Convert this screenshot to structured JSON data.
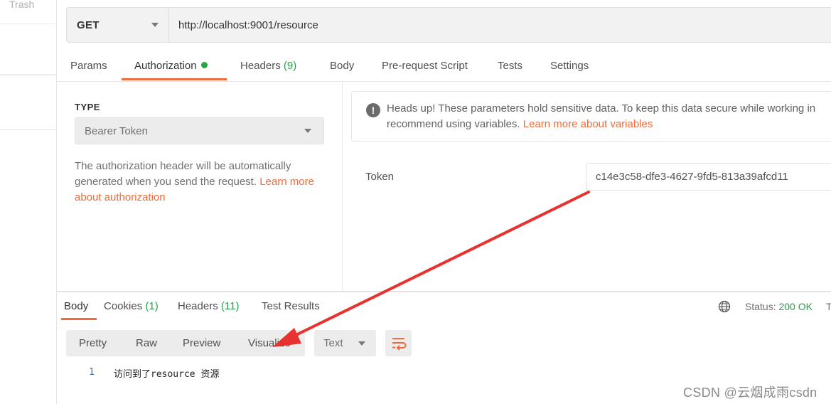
{
  "sidebar": {
    "trash_label": "Trash"
  },
  "request": {
    "method": "GET",
    "url": "http://localhost:9001/resource"
  },
  "request_tabs": {
    "params": "Params",
    "authorization": "Authorization",
    "headers": "Headers",
    "headers_count": "(9)",
    "body": "Body",
    "pre_request": "Pre-request Script",
    "tests": "Tests",
    "settings": "Settings"
  },
  "auth": {
    "type_label": "TYPE",
    "type_value": "Bearer Token",
    "description": "The authorization header will be automatically generated when you send the request. ",
    "learn_link": "Learn more about authorization",
    "notice_line1": "Heads up! These parameters hold sensitive data. To keep this data secure while working in",
    "notice_line2": "recommend using variables. ",
    "notice_link": "Learn more about variables",
    "notice_icon": "!",
    "token_label": "Token",
    "token_value": "c14e3c58-dfe3-4627-9fd5-813a39afcd11"
  },
  "response_tabs": {
    "body": "Body",
    "cookies": "Cookies",
    "cookies_count": "(1)",
    "headers": "Headers",
    "headers_count": "(11)",
    "test_results": "Test Results"
  },
  "status": {
    "label": "Status:",
    "value": "200 OK",
    "trail": "T"
  },
  "view_modes": {
    "pretty": "Pretty",
    "raw": "Raw",
    "preview": "Preview",
    "visualize": "Visualize"
  },
  "format": "Text",
  "code": {
    "line_number": "1",
    "content": "访问到了resource 资源"
  },
  "watermark": "CSDN @云烟成雨csdn",
  "colors": {
    "accent": "#f26b3a",
    "success": "#2a9d4b",
    "annotation_arrow": "#e8322f"
  }
}
